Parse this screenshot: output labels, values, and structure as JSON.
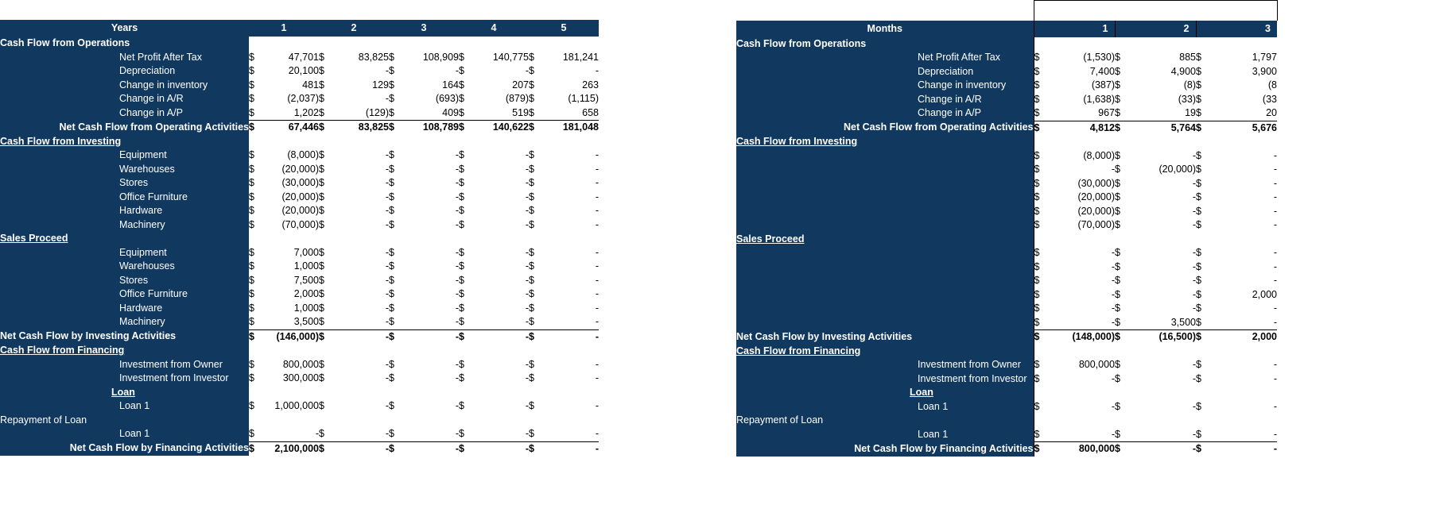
{
  "theme": {
    "header_bg": "#11385f",
    "header_fg": "#ffffff",
    "sheet_bg": "#ffffff",
    "grid_line": "#000000"
  },
  "left_table": {
    "header_label": "Years",
    "columns": [
      "1",
      "2",
      "3",
      "4",
      "5"
    ],
    "rows": [
      {
        "label": "Cash Flow from Operations",
        "style": "section",
        "indent": 0,
        "values": [
          "",
          "",
          "",
          "",
          ""
        ]
      },
      {
        "label": "Net Profit After Tax",
        "style": "item",
        "indent": 2,
        "values": [
          "47,701",
          "83,825",
          "108,909",
          "140,775",
          "181,241"
        ]
      },
      {
        "label": "Depreciation",
        "style": "item",
        "indent": 2,
        "values": [
          "20,100",
          "-",
          "-",
          "-",
          "-"
        ]
      },
      {
        "label": "Change in inventory",
        "style": "item",
        "indent": 2,
        "values": [
          "481",
          "129",
          "164",
          "207",
          "263"
        ]
      },
      {
        "label": "Change in A/R",
        "style": "item",
        "indent": 2,
        "values": [
          "(2,037)",
          "-",
          "(693)",
          "(879)",
          "(1,115)"
        ]
      },
      {
        "label": "Change in A/P",
        "style": "item",
        "indent": 2,
        "values": [
          "1,202",
          "(129)",
          "409",
          "519",
          "658"
        ]
      },
      {
        "label": "Net Cash Flow from Operating Activities",
        "style": "total",
        "indent": 1,
        "values": [
          "67,446",
          "83,825",
          "108,789",
          "140,622",
          "181,048"
        ]
      },
      {
        "label": "Cash Flow from Investing ",
        "style": "section-u",
        "indent": 0,
        "values": [
          "",
          "",
          "",
          "",
          ""
        ]
      },
      {
        "label": "Equipment",
        "style": "item",
        "indent": 2,
        "values": [
          "(8,000)",
          "-",
          "-",
          "-",
          "-"
        ]
      },
      {
        "label": "Warehouses",
        "style": "item",
        "indent": 2,
        "values": [
          "(20,000)",
          "-",
          "-",
          "-",
          "-"
        ]
      },
      {
        "label": "Stores",
        "style": "item",
        "indent": 2,
        "values": [
          "(30,000)",
          "-",
          "-",
          "-",
          "-"
        ]
      },
      {
        "label": "Office Furniture",
        "style": "item",
        "indent": 2,
        "values": [
          "(20,000)",
          "-",
          "-",
          "-",
          "-"
        ]
      },
      {
        "label": "Hardware",
        "style": "item",
        "indent": 2,
        "values": [
          "(20,000)",
          "-",
          "-",
          "-",
          "-"
        ]
      },
      {
        "label": "Machinery",
        "style": "item",
        "indent": 2,
        "values": [
          "(70,000)",
          "-",
          "-",
          "-",
          "-"
        ]
      },
      {
        "label": "Sales Proceed  ",
        "style": "section-u",
        "indent": 0,
        "values": [
          "",
          "",
          "",
          "",
          ""
        ]
      },
      {
        "label": "Equipment",
        "style": "item",
        "indent": 2,
        "values": [
          "7,000",
          "-",
          "-",
          "-",
          "-"
        ]
      },
      {
        "label": "Warehouses",
        "style": "item",
        "indent": 2,
        "values": [
          "1,000",
          "-",
          "-",
          "-",
          "-"
        ]
      },
      {
        "label": "Stores",
        "style": "item",
        "indent": 2,
        "values": [
          "7,500",
          "-",
          "-",
          "-",
          "-"
        ]
      },
      {
        "label": "Office Furniture",
        "style": "item",
        "indent": 2,
        "values": [
          "2,000",
          "-",
          "-",
          "-",
          "-"
        ]
      },
      {
        "label": "Hardware",
        "style": "item",
        "indent": 2,
        "values": [
          "1,000",
          "-",
          "-",
          "-",
          "-"
        ]
      },
      {
        "label": "Machinery",
        "style": "item",
        "indent": 2,
        "values": [
          "3,500",
          "-",
          "-",
          "-",
          "-"
        ]
      },
      {
        "label": "Net Cash Flow by Investing Activities",
        "style": "total-left",
        "indent": 0,
        "values": [
          "(146,000)",
          "-",
          "-",
          "-",
          "-"
        ]
      },
      {
        "label": "Cash Flow from Financing ",
        "style": "section-u",
        "indent": 0,
        "values": [
          "",
          "",
          "",
          "",
          ""
        ]
      },
      {
        "label": "Investment from Owner",
        "style": "item",
        "indent": 2,
        "values": [
          "800,000",
          "-",
          "-",
          "-",
          "-"
        ]
      },
      {
        "label": "Investment from Investor",
        "style": "item",
        "indent": 2,
        "values": [
          "300,000",
          "-",
          "-",
          "-",
          "-"
        ]
      },
      {
        "label": "Loan ",
        "style": "sub-u",
        "indent": 2,
        "values": [
          "",
          "",
          "",
          "",
          ""
        ]
      },
      {
        "label": "Loan 1",
        "style": "item",
        "indent": 2,
        "values": [
          "1,000,000",
          "-",
          "-",
          "-",
          "-"
        ]
      },
      {
        "label": "Repayment of Loan",
        "style": "plain-left",
        "indent": 0,
        "values": [
          "",
          "",
          "",
          "",
          ""
        ]
      },
      {
        "label": "Loan 1",
        "style": "item",
        "indent": 2,
        "values": [
          "-",
          "-",
          "-",
          "-",
          "-"
        ]
      },
      {
        "label": "Net Cash Flow by Financing Activities",
        "style": "total",
        "indent": 1,
        "values": [
          "2,100,000",
          "-",
          "-",
          "-",
          "-"
        ]
      }
    ]
  },
  "right_table": {
    "header_label": "Months",
    "columns": [
      "1",
      "2",
      "3"
    ],
    "rows": [
      {
        "label": "Cash Flow from Operations",
        "style": "section",
        "indent": 0,
        "values": [
          "",
          "",
          ""
        ]
      },
      {
        "label": "Net Profit After Tax",
        "style": "item",
        "indent": 2,
        "values": [
          "(1,530)",
          "885",
          "1,797"
        ]
      },
      {
        "label": "Depreciation",
        "style": "item",
        "indent": 2,
        "values": [
          "7,400",
          "4,900",
          "3,900"
        ]
      },
      {
        "label": "Change in inventory",
        "style": "item",
        "indent": 2,
        "values": [
          "(387)",
          "(8)",
          "(8"
        ]
      },
      {
        "label": "Change in A/R",
        "style": "item",
        "indent": 2,
        "values": [
          "(1,638)",
          "(33)",
          "(33"
        ]
      },
      {
        "label": "Change in A/P",
        "style": "item",
        "indent": 2,
        "values": [
          "967",
          "19",
          "20"
        ]
      },
      {
        "label": "Net Cash Flow from Operating Activities",
        "style": "total",
        "indent": 1,
        "values": [
          "4,812",
          "5,764",
          "5,676"
        ]
      },
      {
        "label": "Cash Flow from Investing ",
        "style": "section-u",
        "indent": 0,
        "values": [
          "",
          "",
          ""
        ]
      },
      {
        "label": "",
        "style": "item",
        "indent": 2,
        "values": [
          "(8,000)",
          "-",
          "-"
        ]
      },
      {
        "label": "",
        "style": "item",
        "indent": 2,
        "values": [
          "-",
          "(20,000)",
          "-"
        ]
      },
      {
        "label": "",
        "style": "item",
        "indent": 2,
        "values": [
          "(30,000)",
          "-",
          "-"
        ]
      },
      {
        "label": "",
        "style": "item",
        "indent": 2,
        "values": [
          "(20,000)",
          "-",
          "-"
        ]
      },
      {
        "label": "",
        "style": "item",
        "indent": 2,
        "values": [
          "(20,000)",
          "-",
          "-"
        ]
      },
      {
        "label": "",
        "style": "item",
        "indent": 2,
        "values": [
          "(70,000)",
          "-",
          "-"
        ]
      },
      {
        "label": "Sales Proceed  ",
        "style": "section-u",
        "indent": 0,
        "values": [
          "",
          "",
          ""
        ]
      },
      {
        "label": "",
        "style": "item",
        "indent": 2,
        "values": [
          "-",
          "-",
          "-"
        ]
      },
      {
        "label": "",
        "style": "item",
        "indent": 2,
        "values": [
          "-",
          "-",
          "-"
        ]
      },
      {
        "label": "",
        "style": "item",
        "indent": 2,
        "values": [
          "-",
          "-",
          "-"
        ]
      },
      {
        "label": "",
        "style": "item",
        "indent": 2,
        "values": [
          "-",
          "-",
          "2,000"
        ]
      },
      {
        "label": "",
        "style": "item",
        "indent": 2,
        "values": [
          "-",
          "-",
          "-"
        ]
      },
      {
        "label": "",
        "style": "item",
        "indent": 2,
        "values": [
          "-",
          "3,500",
          "-"
        ]
      },
      {
        "label": "Net Cash Flow by Investing Activities",
        "style": "total-left",
        "indent": 0,
        "values": [
          "(148,000)",
          "(16,500)",
          "2,000"
        ]
      },
      {
        "label": "Cash Flow from Financing ",
        "style": "section-u",
        "indent": 0,
        "values": [
          "",
          "",
          ""
        ]
      },
      {
        "label": "Investment from Owner",
        "style": "item",
        "indent": 2,
        "values": [
          "800,000",
          "-",
          "-"
        ]
      },
      {
        "label": "Investment from Investor",
        "style": "item",
        "indent": 2,
        "values": [
          "-",
          "-",
          "-"
        ]
      },
      {
        "label": "Loan ",
        "style": "sub-u",
        "indent": 2,
        "values": [
          "",
          "",
          ""
        ]
      },
      {
        "label": "Loan 1",
        "style": "item",
        "indent": 2,
        "values": [
          "-",
          "-",
          "-"
        ]
      },
      {
        "label": "Repayment of Loan",
        "style": "plain-left",
        "indent": 0,
        "values": [
          "",
          "",
          ""
        ]
      },
      {
        "label": "Loan 1",
        "style": "item",
        "indent": 2,
        "values": [
          "-",
          "-",
          "-"
        ]
      },
      {
        "label": "Net Cash Flow by Financing Activities",
        "style": "total",
        "indent": 1,
        "values": [
          "800,000",
          "-",
          "-"
        ]
      }
    ]
  },
  "currency_symbol": "$"
}
